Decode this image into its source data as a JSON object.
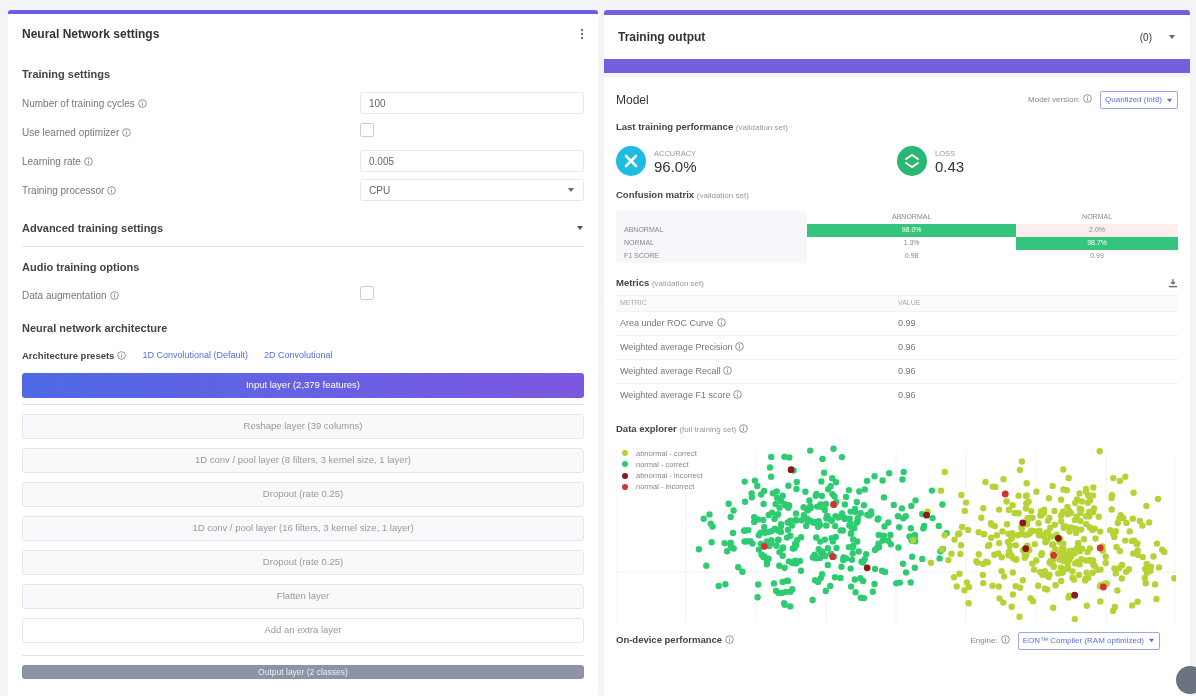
{
  "settings_panel": {
    "title": "Neural Network settings",
    "training_settings": {
      "heading": "Training settings",
      "fields": [
        {
          "kind": "text",
          "label": "Number of training cycles",
          "value": "100"
        },
        {
          "kind": "checkbox",
          "label": "Use learned optimizer",
          "checked": false
        },
        {
          "kind": "text",
          "label": "Learning rate",
          "value": "0.005"
        },
        {
          "kind": "select",
          "label": "Training processor",
          "value": "CPU"
        }
      ]
    },
    "advanced": {
      "label": "Advanced training settings",
      "expanded": false
    },
    "audio_options": {
      "heading": "Audio training options",
      "fields": [
        {
          "kind": "checkbox",
          "label": "Data augmentation",
          "checked": false
        }
      ]
    },
    "architecture": {
      "heading": "Neural network architecture",
      "presets_label": "Architecture presets",
      "presets": [
        "1D Convolutional (Default)",
        "2D Convolutional"
      ],
      "layers": [
        {
          "kind": "input",
          "label": "Input layer (2,379 features)"
        },
        {
          "kind": "layer",
          "label": "Reshape layer (39 columns)"
        },
        {
          "kind": "layer",
          "label": "1D conv / pool layer (8 filters, 3 kernel size, 1 layer)"
        },
        {
          "kind": "layer",
          "label": "Dropout (rate 0.25)"
        },
        {
          "kind": "layer",
          "label": "1D conv / pool layer (16 filters, 3 kernel size, 1 layer)"
        },
        {
          "kind": "layer",
          "label": "Dropout (rate 0.25)"
        },
        {
          "kind": "layer",
          "label": "Flatten layer"
        },
        {
          "kind": "add",
          "label": "Add an extra layer"
        },
        {
          "kind": "output",
          "label": "Output layer (2 classes)"
        }
      ]
    }
  },
  "training_output": {
    "title": "Training output",
    "count": "(0)"
  },
  "model": {
    "title": "Model",
    "version_label": "Model version:",
    "version_value": "Quantized (int8)",
    "performance": {
      "heading": "Last training performance",
      "note": "(validation set)",
      "stats": [
        {
          "kind": "accuracy",
          "label": "ACCURACY",
          "value": "96.0%"
        },
        {
          "kind": "loss",
          "label": "LOSS",
          "value": "0.43"
        }
      ]
    },
    "confusion": {
      "heading": "Confusion matrix",
      "note": "(validation set)",
      "columns": [
        "ABNORMAL",
        "NORMAL"
      ],
      "rows": [
        {
          "label": "ABNORMAL",
          "cells": [
            {
              "value": "98.0%",
              "kind": "correct"
            },
            {
              "value": "2.0%",
              "kind": "wrong"
            }
          ]
        },
        {
          "label": "NORMAL",
          "cells": [
            {
              "value": "1.3%",
              "kind": "plain"
            },
            {
              "value": "98.7%",
              "kind": "correct"
            }
          ]
        },
        {
          "label": "F1 SCORE",
          "cells": [
            {
              "value": "0.98",
              "kind": "plain"
            },
            {
              "value": "0.99",
              "kind": "plain"
            }
          ]
        }
      ]
    },
    "metrics": {
      "heading": "Metrics",
      "note": "(validation set)",
      "columns": [
        "METRIC",
        "VALUE"
      ],
      "rows": [
        {
          "label": "Area under ROC Curve",
          "value": "0.99"
        },
        {
          "label": "Weighted average Precision",
          "value": "0.96"
        },
        {
          "label": "Weighted average Recall",
          "value": "0.96"
        },
        {
          "label": "Weighted average F1 score",
          "value": "0.96"
        }
      ]
    },
    "explorer": {
      "heading": "Data explorer",
      "note": "(full training set)",
      "legend": [
        {
          "label": "abnormal - correct",
          "color": "#b5d334"
        },
        {
          "label": "normal - correct",
          "color": "#2ecc71"
        },
        {
          "label": "abnormal - incorrect",
          "color": "#8b1a1a"
        },
        {
          "label": "normal - incorrect",
          "color": "#d63031"
        }
      ]
    },
    "on_device": {
      "heading": "On-device performance",
      "engine_label": "Engine:",
      "engine_value": "EON™ Compiler (RAM optimized)"
    }
  }
}
